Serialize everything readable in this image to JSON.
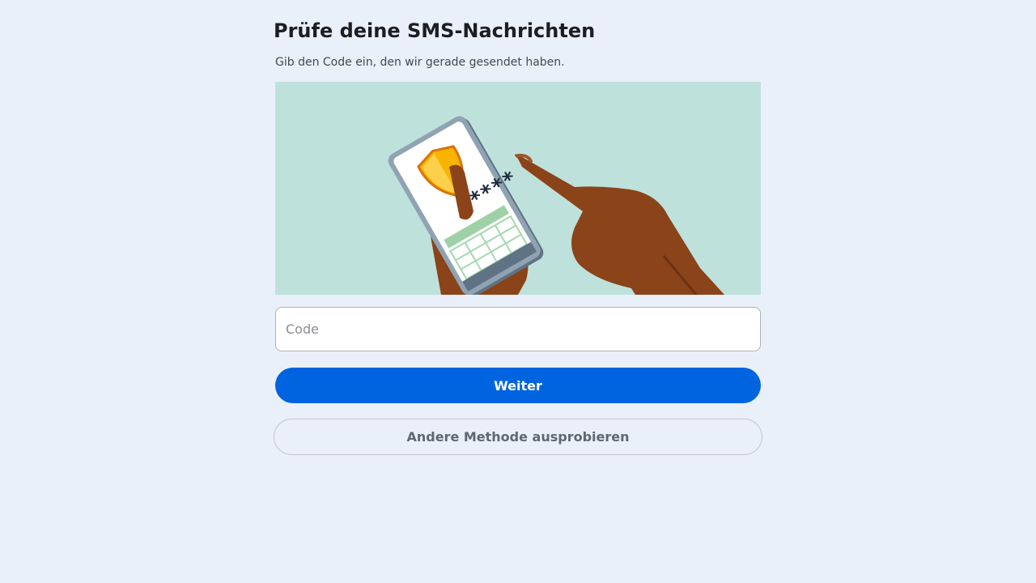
{
  "page": {
    "title": "Prüfe deine SMS-Nachrichten",
    "subtitle": "Gib den Code ein, den wir gerade gesendet haben."
  },
  "illustration": {
    "icon": "hands-holding-phone-with-shield-illustration",
    "code_mask": "****",
    "background_color": "#bfe1dc"
  },
  "form": {
    "code_placeholder": "Code",
    "code_value": "",
    "submit_label": "Weiter",
    "alternative_label": "Andere Methode ausprobieren"
  },
  "colors": {
    "page_background": "#e9f0f9",
    "primary": "#0064e0",
    "secondary_text": "#606770"
  }
}
